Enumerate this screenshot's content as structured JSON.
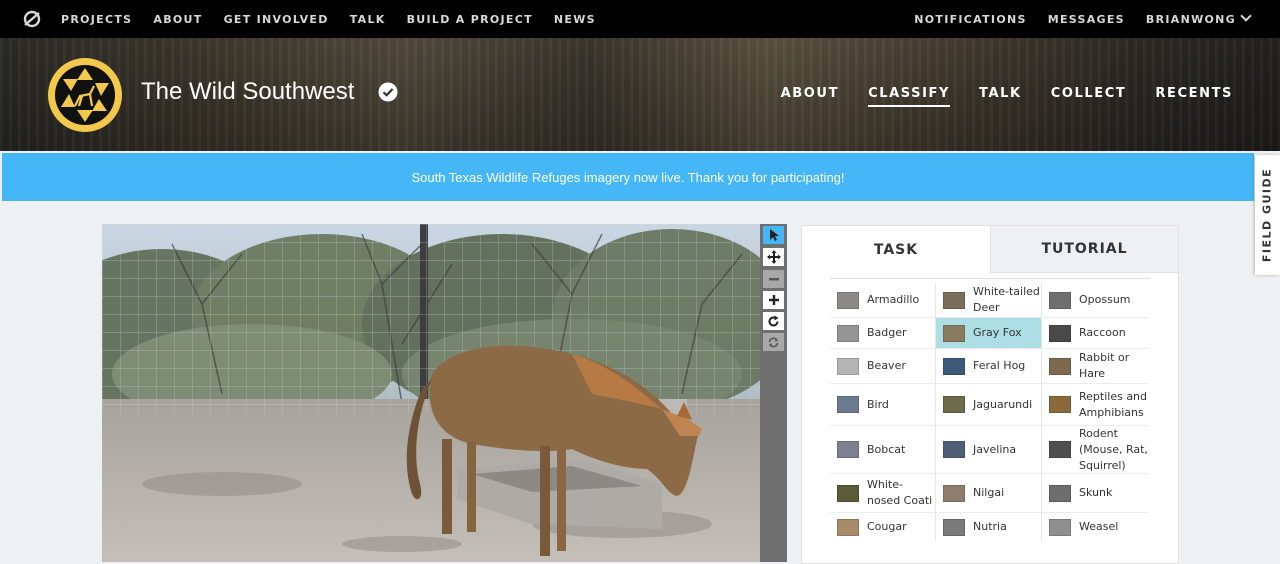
{
  "topnav": {
    "left": [
      "PROJECTS",
      "ABOUT",
      "GET INVOLVED",
      "TALK",
      "BUILD A PROJECT",
      "NEWS"
    ],
    "right": [
      "NOTIFICATIONS",
      "MESSAGES",
      "BRIANWONG"
    ]
  },
  "project": {
    "title": "The Wild Southwest",
    "nav": [
      "ABOUT",
      "CLASSIFY",
      "TALK",
      "COLLECT",
      "RECENTS"
    ],
    "active_nav": "CLASSIFY"
  },
  "announcement": "South Texas Wildlife Refuges imagery now live. Thank you for participating!",
  "field_guide": "FIELD GUIDE",
  "task": {
    "tabs": [
      "TASK",
      "TUTORIAL"
    ],
    "active_tab": "TASK",
    "choices": [
      {
        "label": "Armadillo",
        "color": "#8c8a86"
      },
      {
        "label": "White-tailed Deer",
        "color": "#7b6f5c"
      },
      {
        "label": "Opossum",
        "color": "#6f6f6f"
      },
      {
        "label": "Badger",
        "color": "#959595"
      },
      {
        "label": "Gray Fox",
        "color": "#8a7a5e",
        "selected": true
      },
      {
        "label": "Raccoon",
        "color": "#4a4a4a"
      },
      {
        "label": "Beaver",
        "color": "#b4b4b4"
      },
      {
        "label": "Feral Hog",
        "color": "#3e5a7a"
      },
      {
        "label": "Rabbit or Hare",
        "color": "#7d6a4e"
      },
      {
        "label": "Bird",
        "color": "#6b7a8e"
      },
      {
        "label": "Jaguarundi",
        "color": "#6f6a4a"
      },
      {
        "label": "Reptiles and Amphibians",
        "color": "#8a6a3a"
      },
      {
        "label": "Bobcat",
        "color": "#7c8090"
      },
      {
        "label": "Javelina",
        "color": "#4f5f78"
      },
      {
        "label": "Rodent (Mouse, Rat, Squirrel)",
        "color": "#505050"
      },
      {
        "label": "White-nosed Coati",
        "color": "#5a5a36"
      },
      {
        "label": "Nilgai",
        "color": "#8e7e70"
      },
      {
        "label": "Skunk",
        "color": "#6e6e6e"
      },
      {
        "label": "Cougar",
        "color": "#a88a6a"
      },
      {
        "label": "Nutria",
        "color": "#7a7a7a"
      },
      {
        "label": "Weasel",
        "color": "#8f8f8f"
      }
    ]
  },
  "colors": {
    "accent": "#45b7f7",
    "selected": "#acdee3",
    "logo_ring": "#f2c94c"
  }
}
